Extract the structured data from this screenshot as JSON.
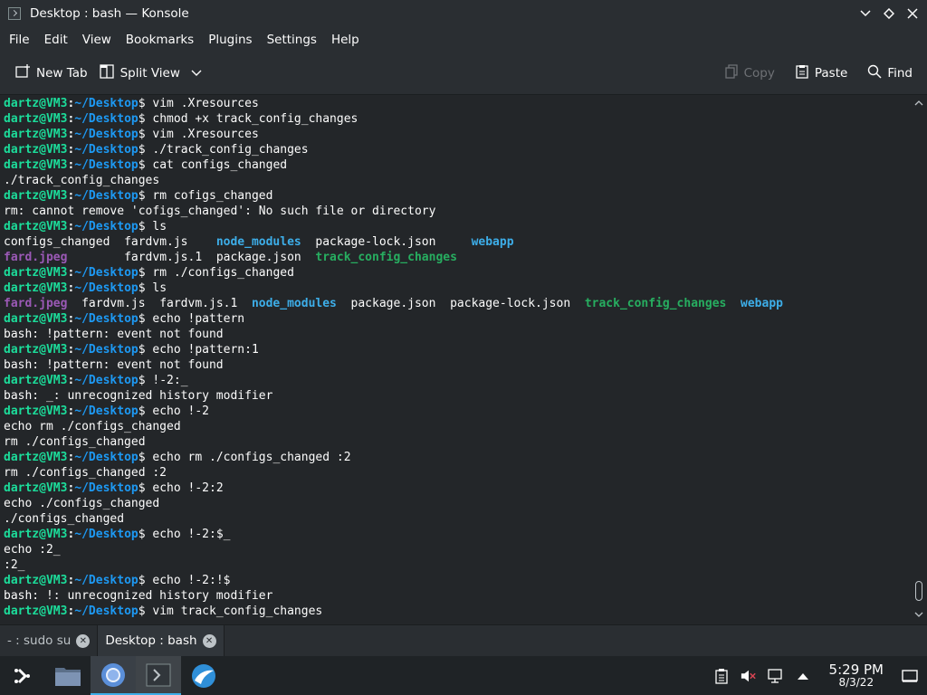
{
  "window": {
    "title": "Desktop : bash — Konsole",
    "icons": [
      "minimize-icon",
      "restore-icon",
      "close-icon"
    ]
  },
  "menubar": {
    "items": [
      "File",
      "Edit",
      "View",
      "Bookmarks",
      "Plugins",
      "Settings",
      "Help"
    ]
  },
  "toolbar": {
    "new_tab": "New Tab",
    "split_view": "Split View",
    "copy": "Copy",
    "paste": "Paste",
    "find": "Find"
  },
  "prompt": {
    "user": "dartz@VM3",
    "path": "~/Desktop",
    "symbol": "$"
  },
  "terminal": {
    "lines": [
      {
        "t": "prompt",
        "cmd": " vim .Xresources"
      },
      {
        "t": "prompt",
        "cmd": " chmod +x track_config_changes"
      },
      {
        "t": "prompt",
        "cmd": " vim .Xresources"
      },
      {
        "t": "prompt",
        "cmd": " ./track_config_changes"
      },
      {
        "t": "prompt",
        "cmd": " cat configs_changed"
      },
      {
        "t": "out",
        "text": "./track_config_changes"
      },
      {
        "t": "prompt",
        "cmd": " rm cofigs_changed"
      },
      {
        "t": "out",
        "text": "rm: cannot remove 'cofigs_changed': No such file or directory"
      },
      {
        "t": "prompt",
        "cmd": " ls"
      },
      {
        "t": "ls",
        "parts": [
          [
            "configs_changed  ",
            ""
          ],
          [
            "fardvm.js    ",
            ""
          ],
          [
            "node_modules",
            "dir"
          ],
          [
            "  package-lock.json     ",
            ""
          ],
          [
            "webapp",
            "dir"
          ]
        ]
      },
      {
        "t": "ls",
        "parts": [
          [
            "fard.jpeg",
            "img"
          ],
          [
            "        fardvm.js.1  package.json  ",
            ""
          ],
          [
            "track_config_changes",
            "exe"
          ]
        ]
      },
      {
        "t": "prompt",
        "cmd": " rm ./configs_changed"
      },
      {
        "t": "prompt",
        "cmd": " ls"
      },
      {
        "t": "ls",
        "parts": [
          [
            "fard.jpeg",
            "img"
          ],
          [
            "  fardvm.js  fardvm.js.1  ",
            ""
          ],
          [
            "node_modules",
            "dir"
          ],
          [
            "  package.json  package-lock.json  ",
            ""
          ],
          [
            "track_config_changes",
            "exe"
          ],
          [
            "  ",
            ""
          ],
          [
            "webapp",
            "dir"
          ]
        ]
      },
      {
        "t": "prompt",
        "cmd": " echo !pattern"
      },
      {
        "t": "out",
        "text": "bash: !pattern: event not found"
      },
      {
        "t": "prompt",
        "cmd": " echo !pattern:1"
      },
      {
        "t": "out",
        "text": "bash: !pattern: event not found"
      },
      {
        "t": "prompt",
        "cmd": " !-2:_"
      },
      {
        "t": "out",
        "text": "bash: _: unrecognized history modifier"
      },
      {
        "t": "prompt",
        "cmd": " echo !-2"
      },
      {
        "t": "out",
        "text": "echo rm ./configs_changed"
      },
      {
        "t": "out",
        "text": "rm ./configs_changed"
      },
      {
        "t": "prompt",
        "cmd": " echo rm ./configs_changed :2"
      },
      {
        "t": "out",
        "text": "rm ./configs_changed :2"
      },
      {
        "t": "prompt",
        "cmd": " echo !-2:2"
      },
      {
        "t": "out",
        "text": "echo ./configs_changed"
      },
      {
        "t": "out",
        "text": "./configs_changed"
      },
      {
        "t": "prompt",
        "cmd": " echo !-2:$_"
      },
      {
        "t": "out",
        "text": "echo :2_"
      },
      {
        "t": "out",
        "text": ":2_"
      },
      {
        "t": "prompt",
        "cmd": " echo !-2:!$"
      },
      {
        "t": "out",
        "text": "bash: !: unrecognized history modifier"
      },
      {
        "t": "prompt",
        "cmd": " vim track_config_changes"
      }
    ]
  },
  "tabs": [
    {
      "label": "- : sudo su",
      "active": false
    },
    {
      "label": "Desktop : bash",
      "active": true
    }
  ],
  "taskbar": {
    "apps": [
      "app-launcher-icon",
      "file-manager-icon",
      "chromium-icon",
      "konsole-icon",
      "browser-icon"
    ],
    "clock_time": "5:29 PM",
    "clock_date": "8/3/22"
  },
  "colors": {
    "prompt_user": "#1cdc9a",
    "prompt_path": "#1d99f3",
    "directory": "#3daee9",
    "image_file": "#9b59b6",
    "executable": "#27ae60"
  }
}
